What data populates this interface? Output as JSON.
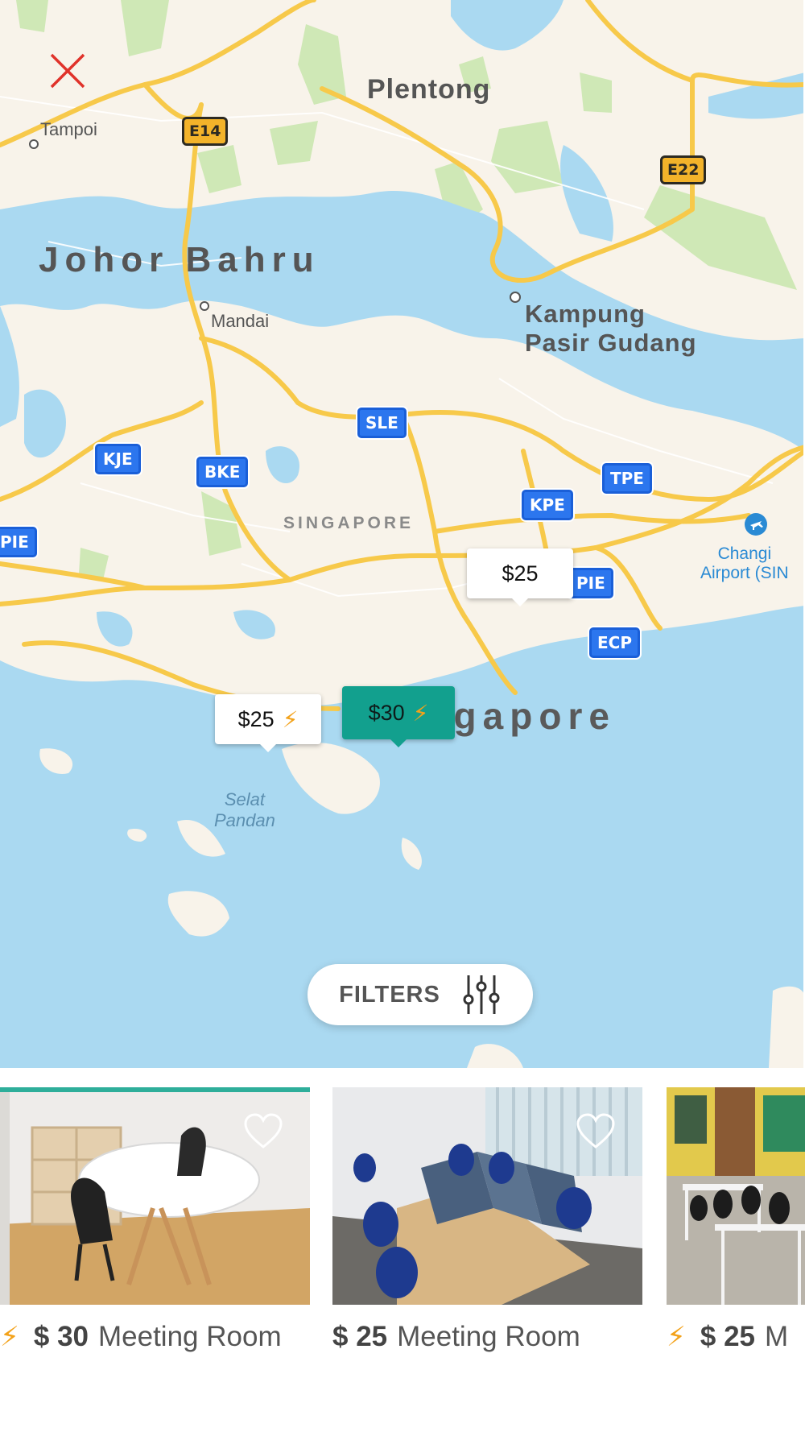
{
  "map": {
    "places": {
      "plentong": "Plentong",
      "tampoi": "Tampoi",
      "johor_bahru": "Johor Bahru",
      "mandai": "Mandai",
      "kampung": "Kampung",
      "pasir_gudang": "Pasir Gudang",
      "singapore_region": "SINGAPORE",
      "singapore_city": "Singapore",
      "selat": "Selat",
      "pandan": "Pandan",
      "changi": "Changi",
      "changi_airport": "Airport (SIN"
    },
    "highways": {
      "e14": "E14",
      "e22": "E22",
      "sle": "SLE",
      "kje": "KJE",
      "bke": "BKE",
      "tpe": "TPE",
      "kpe": "KPE",
      "pie_left": "PIE",
      "pie_right": "PIE",
      "ecp": "ECP"
    },
    "pins": [
      {
        "price": "$25",
        "instant": false,
        "selected": false
      },
      {
        "price": "$25",
        "instant": true,
        "selected": false
      },
      {
        "price": "$30",
        "instant": true,
        "selected": true
      }
    ]
  },
  "filters": {
    "label": "FILTERS",
    "icon": "sliders-icon"
  },
  "close": {
    "icon": "close-icon"
  },
  "cards": [
    {
      "price": "$ 30",
      "type": "Meeting Room",
      "instant": true,
      "selected": true
    },
    {
      "price": "$ 25",
      "type": "Meeting Room",
      "instant": false,
      "selected": false
    },
    {
      "price": "$ 25",
      "type": "M",
      "instant": true,
      "selected": false
    }
  ],
  "colors": {
    "accent": "#2eae9a",
    "pin_selected": "#12a08e",
    "bolt": "#f3a21a",
    "close": "#e0322a",
    "water": "#aad9f1",
    "land": "#f8f3ea",
    "road": "#f7c94a",
    "shield": "#2c76ee"
  }
}
